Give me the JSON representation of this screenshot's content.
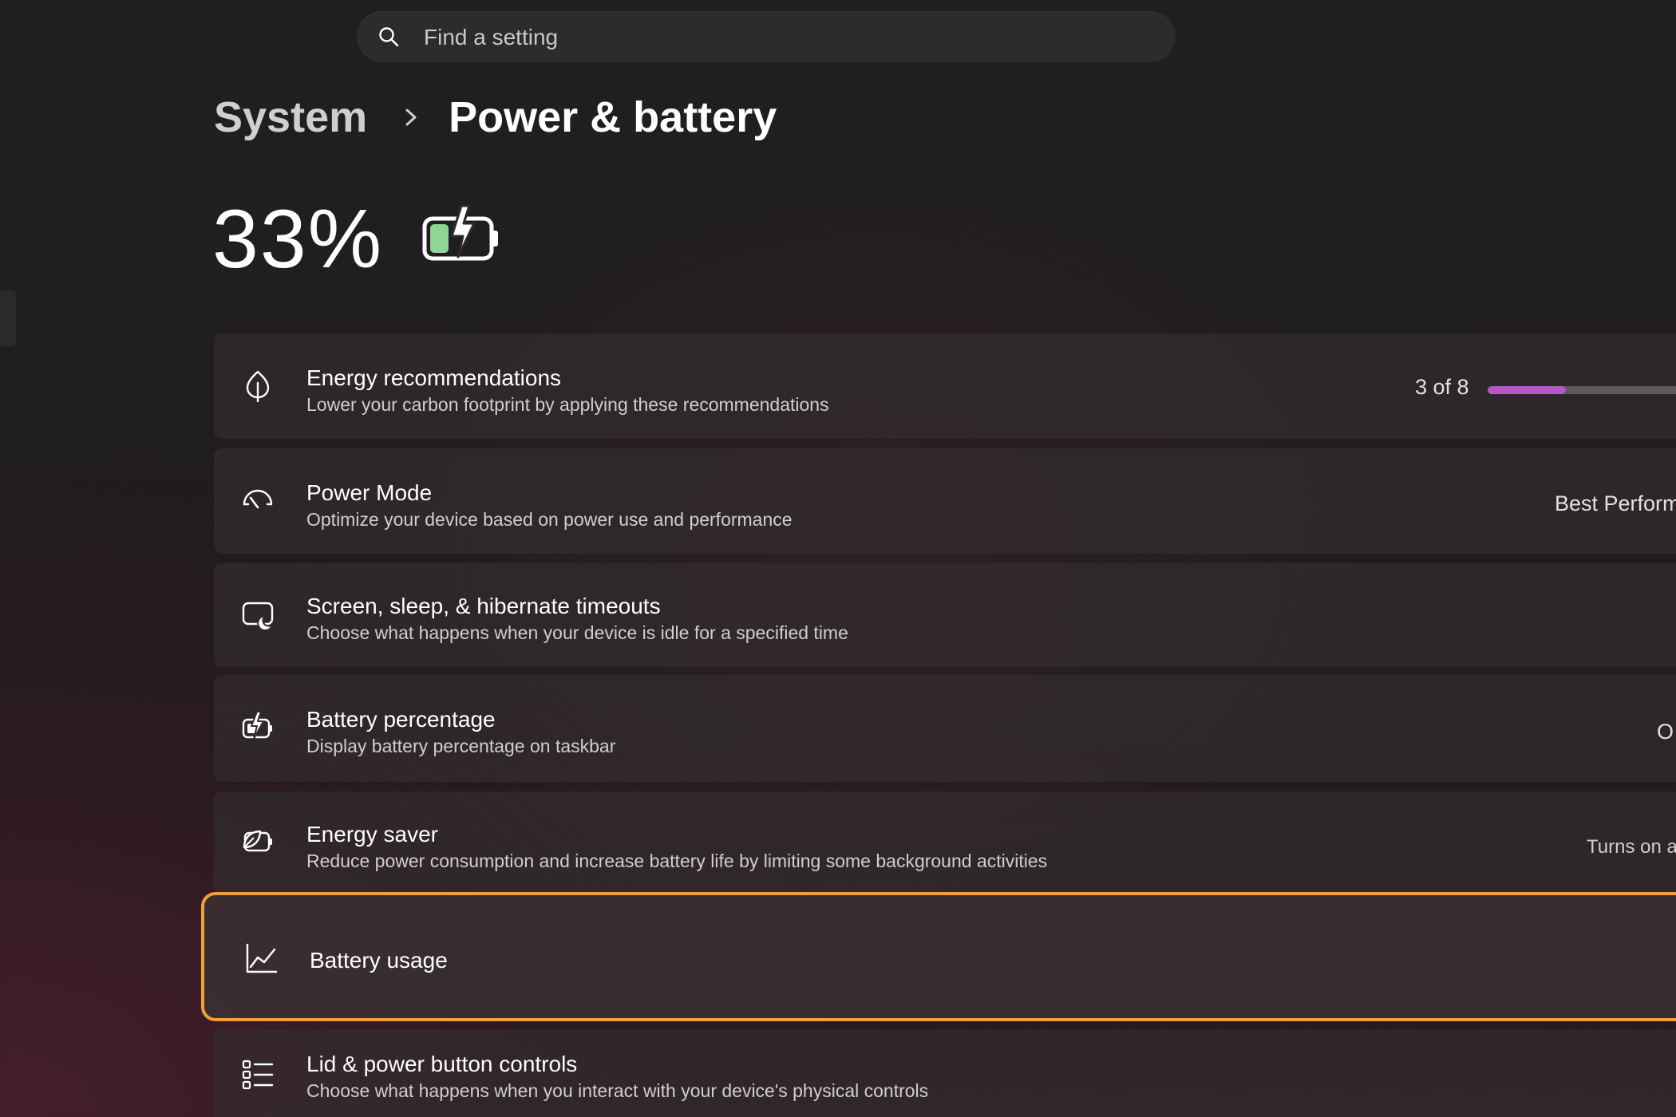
{
  "search": {
    "placeholder": "Find a setting",
    "icon": "search-icon"
  },
  "breadcrumb": {
    "parent": "System",
    "current": "Power & battery"
  },
  "battery": {
    "percent_label": "33%",
    "percent": 33,
    "charging": true,
    "fill_color": "#8fd694",
    "icon": "battery-charging-icon"
  },
  "colors": {
    "accent_progress": "#b658c8",
    "focus_ring": "#f0a03a"
  },
  "settings": [
    {
      "id": "energy-recommendations",
      "icon": "leaf-icon",
      "title": "Energy recommendations",
      "subtitle": "Lower your carbon footprint by applying these recommendations",
      "status": "3 of 8",
      "progress_fraction": 0.375
    },
    {
      "id": "power-mode",
      "icon": "gauge-icon",
      "title": "Power Mode",
      "subtitle": "Optimize your device based on power use and performance",
      "value": "Best Perform"
    },
    {
      "id": "screen-sleep-hibernate",
      "icon": "screen-sleep-icon",
      "title": "Screen, sleep, & hibernate timeouts",
      "subtitle": "Choose what happens when your device is idle for a specified time"
    },
    {
      "id": "battery-percentage",
      "icon": "battery-percentage-icon",
      "title": "Battery percentage",
      "subtitle": "Display battery percentage on taskbar",
      "value": "O"
    },
    {
      "id": "energy-saver",
      "icon": "energy-saver-icon",
      "title": "Energy saver",
      "subtitle": "Reduce power consumption and increase battery life by limiting some background activities",
      "value": "Turns on a"
    },
    {
      "id": "battery-usage",
      "icon": "chart-line-icon",
      "title": "Battery usage",
      "focused": true
    },
    {
      "id": "lid-power-button",
      "icon": "list-icon",
      "title": "Lid & power button controls",
      "subtitle": "Choose what happens when you interact with your device's physical controls"
    }
  ]
}
